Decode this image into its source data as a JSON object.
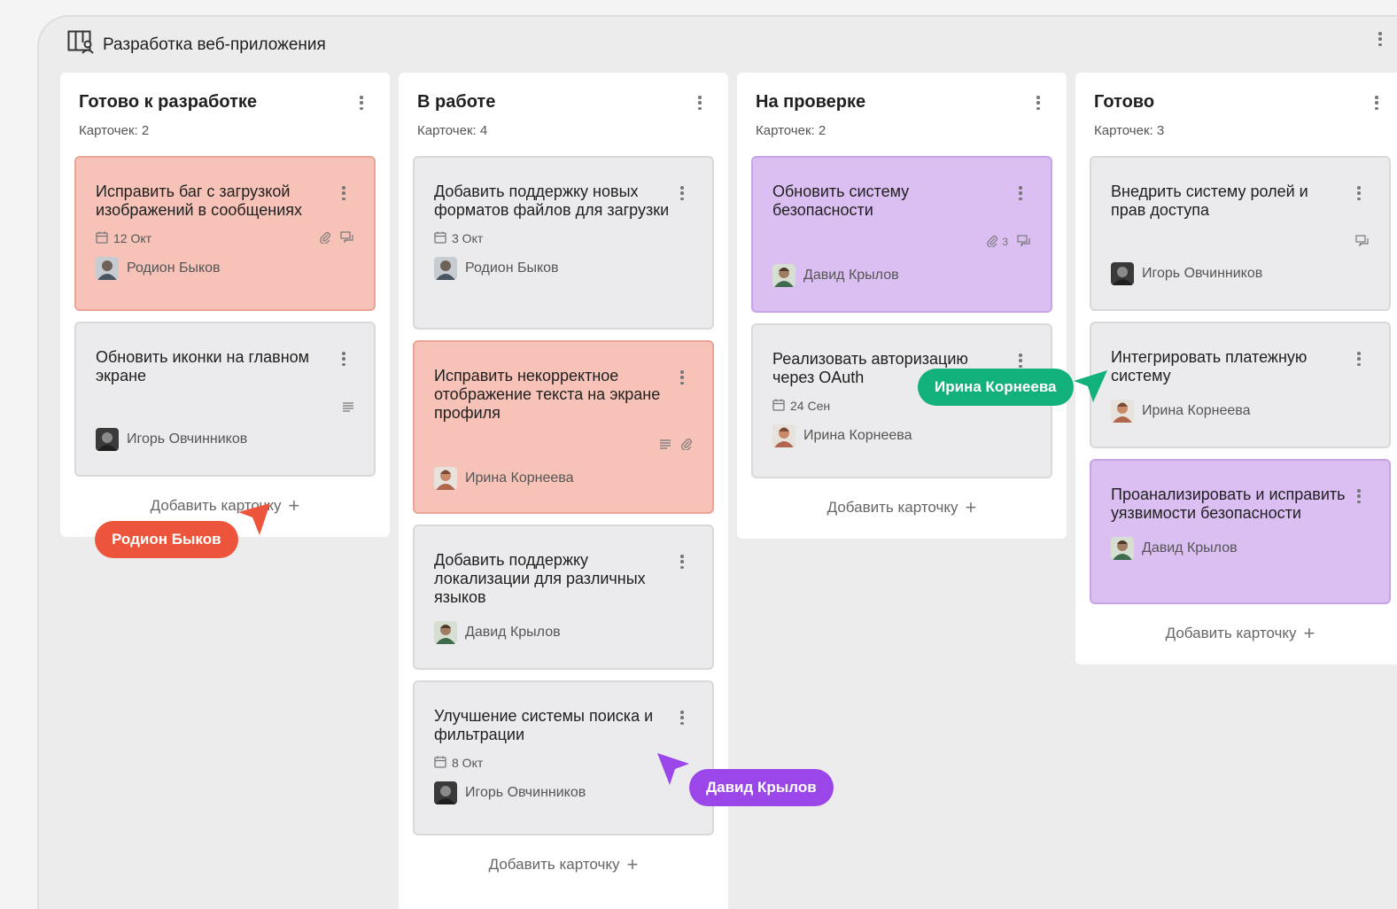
{
  "board": {
    "title": "Разработка веб-приложения",
    "icon": "kanban-board-icon"
  },
  "colors": {
    "card_red": "#f7c3b8",
    "card_purple": "#dbbff2",
    "card_gray": "#ebebee",
    "cursor_red": "#ec553b",
    "cursor_green": "#12b17b",
    "cursor_purple": "#9b46e8"
  },
  "add_card_label": "Добавить карточку",
  "columns": [
    {
      "title": "Готово к разработке",
      "count": "Карточек: 2",
      "cards": [
        {
          "title": "Исправить баг с загрузкой изображений в сообщениях",
          "color": "red",
          "date": "12 Окт",
          "icons": [
            "paperclip-icon",
            "comments-icon"
          ],
          "assignee": "Родион Быков"
        },
        {
          "title": "Обновить иконки на главном экране",
          "color": "gray",
          "icons": [
            "description-icon"
          ],
          "assignee": "Игорь Овчинников"
        }
      ]
    },
    {
      "title": "В работе",
      "count": "Карточек: 4",
      "cards": [
        {
          "title": "Добавить поддержку новых форматов файлов для загрузки",
          "color": "gray",
          "date": "3 Окт",
          "assignee": "Родион Быков"
        },
        {
          "title": "Исправить некорректное отображение текста на экране профиля",
          "color": "red",
          "icons": [
            "description-icon",
            "paperclip-icon"
          ],
          "assignee": "Ирина Корнеева"
        },
        {
          "title": "Добавить поддержку локализации для различных языков",
          "color": "gray",
          "assignee": "Давид Крылов"
        },
        {
          "title": "Улучшение системы поиска и фильтрации",
          "color": "gray",
          "date": "8 Окт",
          "assignee": "Игорь Овчинников"
        }
      ]
    },
    {
      "title": "На проверке",
      "count": "Карточек: 2",
      "cards": [
        {
          "title": "Обновить систему безопасности",
          "color": "purple",
          "attachments": "3",
          "icons": [
            "paperclip-icon",
            "comments-icon"
          ],
          "assignee": "Давид Крылов"
        },
        {
          "title": "Реализовать авторизацию через OAuth",
          "color": "gray",
          "date": "24 Сен",
          "assignee": "Ирина Корнеева"
        }
      ]
    },
    {
      "title": "Готово",
      "count": "Карточек: 3",
      "cards": [
        {
          "title": "Внедрить систему ролей и прав доступа",
          "color": "gray",
          "icons": [
            "comments-icon"
          ],
          "assignee": "Игорь Овчинников"
        },
        {
          "title": "Интегрировать платежную систему",
          "color": "gray",
          "assignee": "Ирина Корнеева"
        },
        {
          "title": "Проанализировать и исправить уязвимости безопасности",
          "color": "purple",
          "assignee": "Давид Крылов"
        }
      ]
    }
  ],
  "cursors": [
    {
      "name": "Родион Быков",
      "color": "#ec553b"
    },
    {
      "name": "Ирина Корнеева",
      "color": "#12b17b"
    },
    {
      "name": "Давид Крылов",
      "color": "#9b46e8"
    }
  ]
}
